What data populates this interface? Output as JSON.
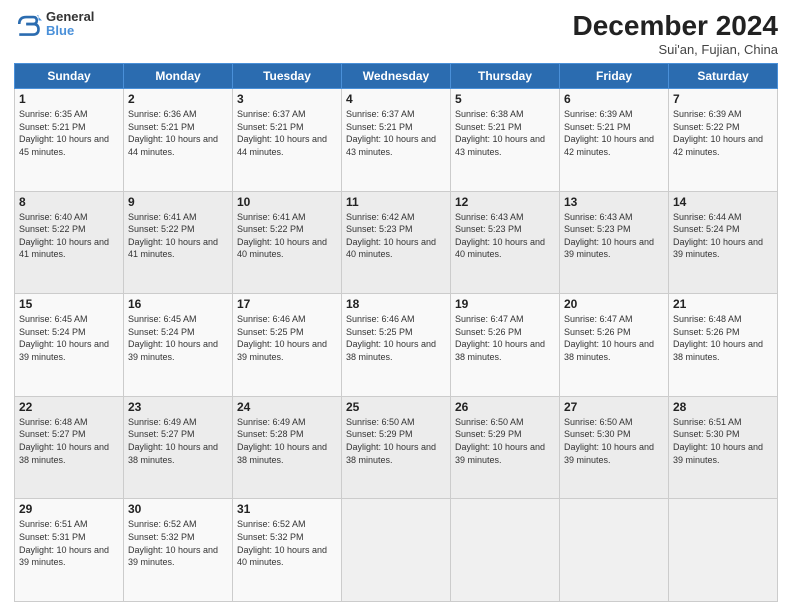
{
  "header": {
    "logo_line1": "General",
    "logo_line2": "Blue",
    "month_title": "December 2024",
    "location": "Sui'an, Fujian, China"
  },
  "days_of_week": [
    "Sunday",
    "Monday",
    "Tuesday",
    "Wednesday",
    "Thursday",
    "Friday",
    "Saturday"
  ],
  "weeks": [
    [
      {
        "num": "1",
        "sunrise": "6:35 AM",
        "sunset": "5:21 PM",
        "daylight": "10 hours and 45 minutes."
      },
      {
        "num": "2",
        "sunrise": "6:36 AM",
        "sunset": "5:21 PM",
        "daylight": "10 hours and 44 minutes."
      },
      {
        "num": "3",
        "sunrise": "6:37 AM",
        "sunset": "5:21 PM",
        "daylight": "10 hours and 44 minutes."
      },
      {
        "num": "4",
        "sunrise": "6:37 AM",
        "sunset": "5:21 PM",
        "daylight": "10 hours and 43 minutes."
      },
      {
        "num": "5",
        "sunrise": "6:38 AM",
        "sunset": "5:21 PM",
        "daylight": "10 hours and 43 minutes."
      },
      {
        "num": "6",
        "sunrise": "6:39 AM",
        "sunset": "5:21 PM",
        "daylight": "10 hours and 42 minutes."
      },
      {
        "num": "7",
        "sunrise": "6:39 AM",
        "sunset": "5:22 PM",
        "daylight": "10 hours and 42 minutes."
      }
    ],
    [
      {
        "num": "8",
        "sunrise": "6:40 AM",
        "sunset": "5:22 PM",
        "daylight": "10 hours and 41 minutes."
      },
      {
        "num": "9",
        "sunrise": "6:41 AM",
        "sunset": "5:22 PM",
        "daylight": "10 hours and 41 minutes."
      },
      {
        "num": "10",
        "sunrise": "6:41 AM",
        "sunset": "5:22 PM",
        "daylight": "10 hours and 40 minutes."
      },
      {
        "num": "11",
        "sunrise": "6:42 AM",
        "sunset": "5:23 PM",
        "daylight": "10 hours and 40 minutes."
      },
      {
        "num": "12",
        "sunrise": "6:43 AM",
        "sunset": "5:23 PM",
        "daylight": "10 hours and 40 minutes."
      },
      {
        "num": "13",
        "sunrise": "6:43 AM",
        "sunset": "5:23 PM",
        "daylight": "10 hours and 39 minutes."
      },
      {
        "num": "14",
        "sunrise": "6:44 AM",
        "sunset": "5:24 PM",
        "daylight": "10 hours and 39 minutes."
      }
    ],
    [
      {
        "num": "15",
        "sunrise": "6:45 AM",
        "sunset": "5:24 PM",
        "daylight": "10 hours and 39 minutes."
      },
      {
        "num": "16",
        "sunrise": "6:45 AM",
        "sunset": "5:24 PM",
        "daylight": "10 hours and 39 minutes."
      },
      {
        "num": "17",
        "sunrise": "6:46 AM",
        "sunset": "5:25 PM",
        "daylight": "10 hours and 39 minutes."
      },
      {
        "num": "18",
        "sunrise": "6:46 AM",
        "sunset": "5:25 PM",
        "daylight": "10 hours and 38 minutes."
      },
      {
        "num": "19",
        "sunrise": "6:47 AM",
        "sunset": "5:26 PM",
        "daylight": "10 hours and 38 minutes."
      },
      {
        "num": "20",
        "sunrise": "6:47 AM",
        "sunset": "5:26 PM",
        "daylight": "10 hours and 38 minutes."
      },
      {
        "num": "21",
        "sunrise": "6:48 AM",
        "sunset": "5:26 PM",
        "daylight": "10 hours and 38 minutes."
      }
    ],
    [
      {
        "num": "22",
        "sunrise": "6:48 AM",
        "sunset": "5:27 PM",
        "daylight": "10 hours and 38 minutes."
      },
      {
        "num": "23",
        "sunrise": "6:49 AM",
        "sunset": "5:27 PM",
        "daylight": "10 hours and 38 minutes."
      },
      {
        "num": "24",
        "sunrise": "6:49 AM",
        "sunset": "5:28 PM",
        "daylight": "10 hours and 38 minutes."
      },
      {
        "num": "25",
        "sunrise": "6:50 AM",
        "sunset": "5:29 PM",
        "daylight": "10 hours and 38 minutes."
      },
      {
        "num": "26",
        "sunrise": "6:50 AM",
        "sunset": "5:29 PM",
        "daylight": "10 hours and 39 minutes."
      },
      {
        "num": "27",
        "sunrise": "6:50 AM",
        "sunset": "5:30 PM",
        "daylight": "10 hours and 39 minutes."
      },
      {
        "num": "28",
        "sunrise": "6:51 AM",
        "sunset": "5:30 PM",
        "daylight": "10 hours and 39 minutes."
      }
    ],
    [
      {
        "num": "29",
        "sunrise": "6:51 AM",
        "sunset": "5:31 PM",
        "daylight": "10 hours and 39 minutes."
      },
      {
        "num": "30",
        "sunrise": "6:52 AM",
        "sunset": "5:32 PM",
        "daylight": "10 hours and 39 minutes."
      },
      {
        "num": "31",
        "sunrise": "6:52 AM",
        "sunset": "5:32 PM",
        "daylight": "10 hours and 40 minutes."
      },
      null,
      null,
      null,
      null
    ]
  ]
}
